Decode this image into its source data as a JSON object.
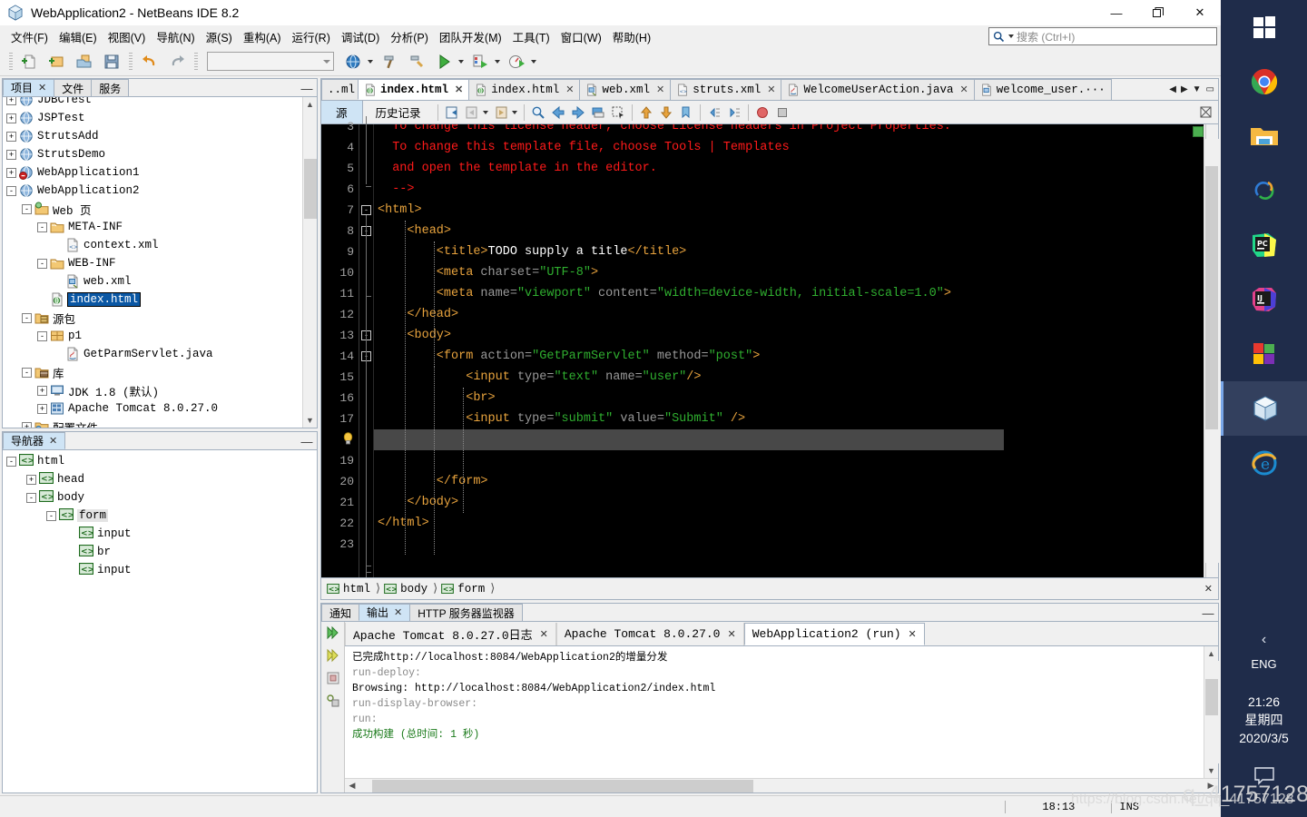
{
  "window": {
    "title": "WebApplication2 - NetBeans IDE 8.2",
    "minimize": "—",
    "restore": "❐",
    "close": "✕"
  },
  "menubar": {
    "items": [
      "文件(F)",
      "编辑(E)",
      "视图(V)",
      "导航(N)",
      "源(S)",
      "重构(A)",
      "运行(R)",
      "调试(D)",
      "分析(P)",
      "团队开发(M)",
      "工具(T)",
      "窗口(W)",
      "帮助(H)"
    ],
    "search_placeholder": "搜索 (Ctrl+I)"
  },
  "projects_panel": {
    "tabs": [
      {
        "label": "项目",
        "closable": true,
        "active": true
      },
      {
        "label": "文件",
        "closable": false,
        "active": false
      },
      {
        "label": "服务",
        "closable": false,
        "active": false
      }
    ],
    "minimize": "—",
    "tree": [
      {
        "label": "JDBCTest",
        "indent": 0,
        "toggle": "+",
        "icon": "globe-icon",
        "clipped": true
      },
      {
        "label": "JSPTest",
        "indent": 0,
        "toggle": "+",
        "icon": "globe-icon"
      },
      {
        "label": "StrutsAdd",
        "indent": 0,
        "toggle": "+",
        "icon": "globe-icon"
      },
      {
        "label": "StrutsDemo",
        "indent": 0,
        "toggle": "+",
        "icon": "globe-icon"
      },
      {
        "label": "WebApplication1",
        "indent": 0,
        "toggle": "+",
        "icon": "globe-error-icon"
      },
      {
        "label": "WebApplication2",
        "indent": 0,
        "toggle": "-",
        "icon": "globe-icon"
      },
      {
        "label": "Web 页",
        "indent": 1,
        "toggle": "-",
        "icon": "web-folder-icon"
      },
      {
        "label": "META-INF",
        "indent": 2,
        "toggle": "-",
        "icon": "folder-icon"
      },
      {
        "label": "context.xml",
        "indent": 3,
        "toggle": "",
        "icon": "xml-file-icon"
      },
      {
        "label": "WEB-INF",
        "indent": 2,
        "toggle": "-",
        "icon": "folder-icon"
      },
      {
        "label": "web.xml",
        "indent": 3,
        "toggle": "",
        "icon": "webxml-file-icon"
      },
      {
        "label": "index.html",
        "indent": 2,
        "toggle": "",
        "icon": "html-file-icon",
        "selected": true
      },
      {
        "label": "源包",
        "indent": 1,
        "toggle": "-",
        "icon": "source-packages-icon"
      },
      {
        "label": "p1",
        "indent": 2,
        "toggle": "-",
        "icon": "package-icon"
      },
      {
        "label": "GetParmServlet.java",
        "indent": 3,
        "toggle": "",
        "icon": "java-file-icon"
      },
      {
        "label": "库",
        "indent": 1,
        "toggle": "-",
        "icon": "libraries-icon"
      },
      {
        "label": "JDK 1.8 (默认)",
        "indent": 2,
        "toggle": "+",
        "icon": "jdk-icon"
      },
      {
        "label": "Apache Tomcat 8.0.27.0",
        "indent": 2,
        "toggle": "+",
        "icon": "server-icon"
      },
      {
        "label": "配置文件",
        "indent": 1,
        "toggle": "+",
        "icon": "config-folder-icon"
      }
    ]
  },
  "navigator_panel": {
    "tab_label": "导航器",
    "minimize": "—",
    "tree": [
      {
        "label": "html",
        "indent": 0,
        "toggle": "-"
      },
      {
        "label": "head",
        "indent": 1,
        "toggle": "+"
      },
      {
        "label": "body",
        "indent": 1,
        "toggle": "-"
      },
      {
        "label": "form",
        "indent": 2,
        "toggle": "-",
        "soft_selected": true
      },
      {
        "label": "input",
        "indent": 3,
        "toggle": ""
      },
      {
        "label": "br",
        "indent": 3,
        "toggle": ""
      },
      {
        "label": "input",
        "indent": 3,
        "toggle": ""
      }
    ]
  },
  "editor": {
    "tabs": [
      {
        "label": "..ml",
        "icon": "",
        "active": false,
        "clipped": true
      },
      {
        "label": "index.html",
        "icon": "html-file-icon",
        "active": true,
        "closable": true
      },
      {
        "label": "index.html",
        "icon": "html-file-icon",
        "active": false,
        "closable": true
      },
      {
        "label": "web.xml",
        "icon": "webxml-file-icon",
        "active": false,
        "closable": true
      },
      {
        "label": "struts.xml",
        "icon": "xml-file-icon",
        "active": false,
        "closable": true
      },
      {
        "label": "WelcomeUserAction.java",
        "icon": "java-file-icon",
        "active": false,
        "closable": true
      },
      {
        "label": "welcome_user.···",
        "icon": "jsp-file-icon",
        "active": false,
        "closable": false
      }
    ],
    "toolbar": {
      "source_label": "源",
      "history_label": "历史记录"
    },
    "lines": [
      {
        "n": "3",
        "tokens": [
          {
            "t": "  To change this license header, choose License headers in Project Properties.",
            "c": "cmt"
          }
        ],
        "partial": true
      },
      {
        "n": "4",
        "tokens": [
          {
            "t": "  To change this template file, choose Tools | Templates",
            "c": "cmt"
          }
        ]
      },
      {
        "n": "5",
        "tokens": [
          {
            "t": "  and open the template in the editor.",
            "c": "cmt"
          }
        ]
      },
      {
        "n": "6",
        "tokens": [
          {
            "t": "  -->",
            "c": "cmt"
          }
        ]
      },
      {
        "n": "7",
        "tokens": [
          {
            "t": "<html>",
            "c": "tagc"
          }
        ]
      },
      {
        "n": "8",
        "tokens": [
          {
            "t": "    <head>",
            "c": "tagc"
          }
        ]
      },
      {
        "n": "9",
        "tokens": [
          {
            "t": "        <title>",
            "c": "tagc"
          },
          {
            "t": "TODO supply a title",
            "c": "txt"
          },
          {
            "t": "</title>",
            "c": "tagc"
          }
        ]
      },
      {
        "n": "10",
        "tokens": [
          {
            "t": "        <meta ",
            "c": "tagc"
          },
          {
            "t": "charset=",
            "c": "attr"
          },
          {
            "t": "\"UTF-8\"",
            "c": "val"
          },
          {
            "t": ">",
            "c": "tagc"
          }
        ]
      },
      {
        "n": "11",
        "tokens": [
          {
            "t": "        <meta ",
            "c": "tagc"
          },
          {
            "t": "name=",
            "c": "attr"
          },
          {
            "t": "\"viewport\"",
            "c": "val"
          },
          {
            "t": " content=",
            "c": "attr"
          },
          {
            "t": "\"width=device-width, initial-scale=1.0\"",
            "c": "val"
          },
          {
            "t": ">",
            "c": "tagc"
          }
        ]
      },
      {
        "n": "12",
        "tokens": [
          {
            "t": "    </head>",
            "c": "tagc"
          }
        ]
      },
      {
        "n": "13",
        "tokens": [
          {
            "t": "    <body>",
            "c": "tagc"
          }
        ]
      },
      {
        "n": "14",
        "tokens": [
          {
            "t": "        <form ",
            "c": "tagc"
          },
          {
            "t": "action=",
            "c": "attr"
          },
          {
            "t": "\"GetParmServlet\"",
            "c": "val"
          },
          {
            "t": " method=",
            "c": "attr"
          },
          {
            "t": "\"post\"",
            "c": "val"
          },
          {
            "t": ">",
            "c": "tagc"
          }
        ]
      },
      {
        "n": "15",
        "tokens": [
          {
            "t": "            <input ",
            "c": "tagc"
          },
          {
            "t": "type=",
            "c": "attr"
          },
          {
            "t": "\"text\"",
            "c": "val"
          },
          {
            "t": " name=",
            "c": "attr"
          },
          {
            "t": "\"user\"",
            "c": "val"
          },
          {
            "t": "/>",
            "c": "tagc"
          }
        ]
      },
      {
        "n": "16",
        "tokens": [
          {
            "t": "            <br>",
            "c": "tagc"
          }
        ]
      },
      {
        "n": "17",
        "tokens": [
          {
            "t": "            <input ",
            "c": "tagc"
          },
          {
            "t": "type=",
            "c": "attr"
          },
          {
            "t": "\"submit\"",
            "c": "val"
          },
          {
            "t": " value=",
            "c": "attr"
          },
          {
            "t": "\"Submit\"",
            "c": "val"
          },
          {
            "t": " />",
            "c": "tagc"
          }
        ]
      },
      {
        "n": "",
        "tokens": [],
        "current": true,
        "hint": "lightbulb-icon"
      },
      {
        "n": "19",
        "tokens": []
      },
      {
        "n": "20",
        "tokens": [
          {
            "t": "        </form>",
            "c": "tagc"
          }
        ]
      },
      {
        "n": "21",
        "tokens": [
          {
            "t": "    </body>",
            "c": "tagc"
          }
        ]
      },
      {
        "n": "22",
        "tokens": [
          {
            "t": "</html>",
            "c": "tagc"
          }
        ]
      },
      {
        "n": "23",
        "tokens": []
      }
    ]
  },
  "breadcrumb": {
    "items": [
      "html",
      "body",
      "form"
    ],
    "separator": "⟩",
    "close": "✕"
  },
  "output_panel": {
    "tabs": [
      {
        "label": "通知",
        "active": false,
        "closable": false
      },
      {
        "label": "输出",
        "active": true,
        "closable": true
      },
      {
        "label": "HTTP 服务器监视器",
        "active": false,
        "closable": false
      }
    ],
    "minimize": "—",
    "subtabs": [
      {
        "label": "Apache Tomcat 8.0.27.0日志",
        "active": false,
        "closable": true
      },
      {
        "label": "Apache Tomcat 8.0.27.0",
        "active": false,
        "closable": true
      },
      {
        "label": "WebApplication2 (run)",
        "active": true,
        "closable": true
      }
    ],
    "lines": [
      {
        "text": "已完成http://localhost:8084/WebApplication2的增量分发",
        "style": "o-black"
      },
      {
        "text": "run-deploy:",
        "style": "o-gray"
      },
      {
        "text": "Browsing: http://localhost:8084/WebApplication2/index.html",
        "style": "o-black"
      },
      {
        "text": "run-display-browser:",
        "style": "o-gray"
      },
      {
        "text": "run:",
        "style": "o-gray"
      },
      {
        "text": "成功构建 (总时间: 1 秒)",
        "style": "o-green"
      }
    ]
  },
  "statusbar": {
    "time": "18:13",
    "ins": "INS"
  },
  "taskbar": {
    "icons": [
      {
        "name": "windows-start-icon",
        "active": false
      },
      {
        "name": "chrome-icon",
        "active": false
      },
      {
        "name": "file-explorer-icon",
        "active": false
      },
      {
        "name": "browser-360-icon",
        "active": false
      },
      {
        "name": "pycharm-icon",
        "active": false
      },
      {
        "name": "intellij-idea-icon",
        "active": false
      },
      {
        "name": "microsoft-store-icon",
        "active": false
      },
      {
        "name": "netbeans-icon",
        "active": true
      },
      {
        "name": "internet-explorer-icon",
        "active": false
      }
    ],
    "chevron": "‹",
    "language": "ENG",
    "time": "21:26",
    "weekday": "星期四",
    "date": "2020/3/5"
  },
  "watermark": {
    "url": "https://blog.csdn.net/qq_41757128",
    "big": "q_41757128"
  }
}
